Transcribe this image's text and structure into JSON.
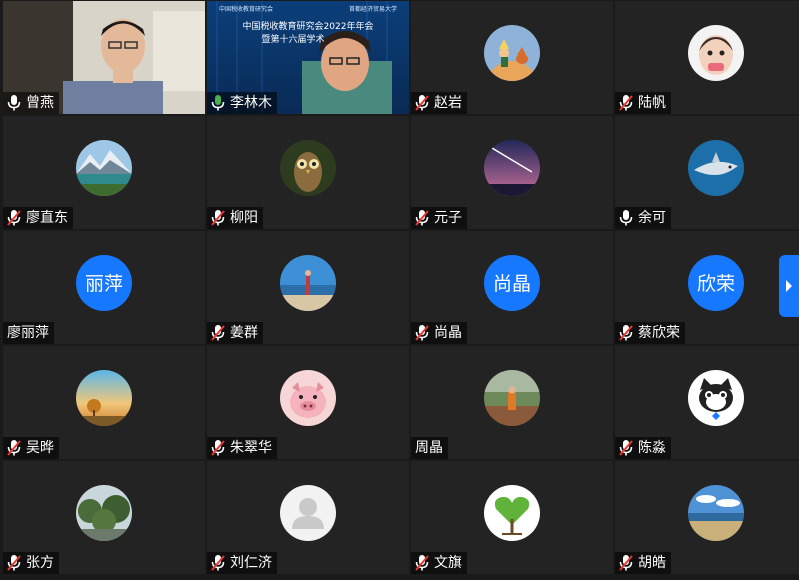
{
  "meeting": {
    "banner_line1": "中国税收教育研究会2022年年会",
    "banner_line2": "暨第十六届学术",
    "banner_small_left": "中国税收教育研究会",
    "banner_small_right": "首都经济贸易大学"
  },
  "colors": {
    "accent": "#1677ff",
    "mic_on": "#4caf50",
    "mic_off": "#e53935"
  },
  "participants": [
    {
      "name": "曾燕",
      "mic": "on",
      "avatar": "camera-video"
    },
    {
      "name": "李林木",
      "mic": "on-green",
      "avatar": "camera-video"
    },
    {
      "name": "赵岩",
      "mic": "muted",
      "avatar": "little-prince-icon"
    },
    {
      "name": "陆帆",
      "mic": "muted",
      "avatar": "child-photo-icon"
    },
    {
      "name": "廖直东",
      "mic": "muted",
      "avatar": "mountain-lake-icon"
    },
    {
      "name": "柳阳",
      "mic": "muted",
      "avatar": "owl-icon"
    },
    {
      "name": "元子",
      "mic": "muted",
      "avatar": "night-sky-icon"
    },
    {
      "name": "余可",
      "mic": "on",
      "avatar": "shark-icon"
    },
    {
      "name": "廖丽萍",
      "mic": "none",
      "avatar": "initials",
      "initials": "丽萍"
    },
    {
      "name": "姜群",
      "mic": "muted",
      "avatar": "beach-person-icon"
    },
    {
      "name": "尚晶",
      "mic": "muted",
      "avatar": "initials",
      "initials": "尚晶"
    },
    {
      "name": "蔡欣荣",
      "mic": "muted",
      "avatar": "initials",
      "initials": "欣荣"
    },
    {
      "name": "吴晔",
      "mic": "muted",
      "avatar": "sunset-tree-icon"
    },
    {
      "name": "朱翠华",
      "mic": "muted",
      "avatar": "pig-icon"
    },
    {
      "name": "周晶",
      "mic": "none",
      "avatar": "playground-icon"
    },
    {
      "name": "陈淼",
      "mic": "muted",
      "avatar": "cat-icon"
    },
    {
      "name": "张方",
      "mic": "muted",
      "avatar": "forest-icon"
    },
    {
      "name": "刘仁济",
      "mic": "muted",
      "avatar": "default-user-icon"
    },
    {
      "name": "文旗",
      "mic": "muted",
      "avatar": "heart-tree-icon"
    },
    {
      "name": "胡皓",
      "mic": "muted",
      "avatar": "lakeside-icon"
    }
  ]
}
